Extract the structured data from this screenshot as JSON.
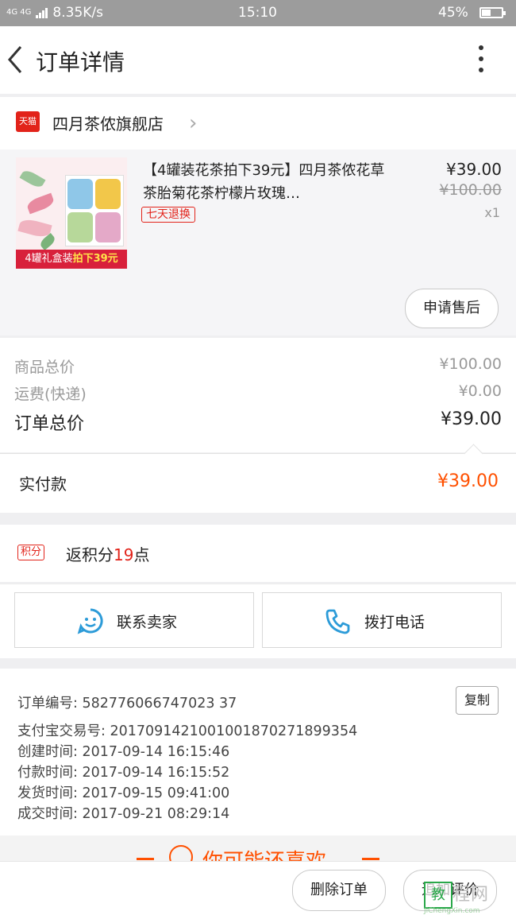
{
  "status_bar": {
    "network": "4G 4G",
    "speed": "8.35K/s",
    "time": "15:10",
    "battery": "45%",
    "battery_level": 0.45
  },
  "header": {
    "title": "订单详情"
  },
  "shop": {
    "badge": "天猫",
    "name": "四月茶侬旗舰店"
  },
  "product": {
    "title": "【4罐装花茶拍下39元】四月茶侬花草茶胎菊花茶柠檬片玫瑰…",
    "tag": "七天退换",
    "price": "¥39.00",
    "original_price": "¥100.00",
    "quantity": "x1",
    "thumb_banner_prefix": "4罐礼盒装",
    "thumb_banner_highlight": "拍下39元",
    "after_sale_label": "申请售后"
  },
  "totals": {
    "goods_label": "商品总价",
    "goods_value": "¥100.00",
    "shipping_label": "运费(快递)",
    "shipping_value": "¥0.00",
    "order_label": "订单总价",
    "order_value": "¥39.00",
    "paid_label": "实付款",
    "paid_value": "¥39.00"
  },
  "points": {
    "badge": "积分",
    "prefix": "返积分",
    "num": "19",
    "suffix": "点"
  },
  "contact": {
    "seller_label": "联系卖家",
    "phone_label": "拨打电话"
  },
  "order_info": {
    "order_no": "订单编号: 582776066747023 37",
    "alipay_no": "支付宝交易号: 2017091421001001870271899354",
    "created": "创建时间: 2017-09-14  16:15:46",
    "paid": "付款时间: 2017-09-14  16:15:52",
    "shipped": "发货时间: 2017-09-15  09:41:00",
    "completed": "成交时间: 2017-09-21  08:29:14",
    "copy_label": "复制"
  },
  "recommend": {
    "title": "你可能还喜欢"
  },
  "actions": {
    "delete_label": "删除订单",
    "review_label": "追加评价"
  },
  "watermark": {
    "logo": "教",
    "name": "程网",
    "url": "JiChengXin.com"
  },
  "colors": {
    "accent_orange": "#ff5000",
    "tmall_red": "#e2231a",
    "icon_blue": "#2c9bd8"
  }
}
